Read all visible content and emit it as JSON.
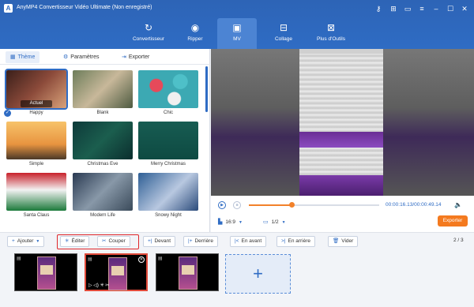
{
  "app": {
    "logo_text": "A",
    "title": "AnyMP4 Convertisseur Vidéo Ultimate (Non enregistré)",
    "titlebar_icons": [
      "key-icon",
      "cart-icon",
      "chat-icon",
      "menu-icon",
      "minimize-icon",
      "maximize-icon",
      "close-icon"
    ]
  },
  "nav": {
    "tabs": [
      {
        "label": "Convertisseur",
        "icon": "convert-icon"
      },
      {
        "label": "Ripper",
        "icon": "disc-icon"
      },
      {
        "label": "MV",
        "icon": "mv-icon",
        "active": true
      },
      {
        "label": "Collage",
        "icon": "collage-icon"
      },
      {
        "label": "Plus d'Outils",
        "icon": "toolbox-icon"
      }
    ]
  },
  "left_panel": {
    "tabs": [
      {
        "label": "Thème",
        "icon": "grid-icon",
        "active": true
      },
      {
        "label": "Paramètres",
        "icon": "settings-icon"
      },
      {
        "label": "Exporter",
        "icon": "export-icon"
      }
    ],
    "themes": [
      {
        "label": "Happy",
        "badge": "Actuel",
        "selected": true
      },
      {
        "label": "Blank"
      },
      {
        "label": "Chic"
      },
      {
        "label": "Simple"
      },
      {
        "label": "Christmas Eve"
      },
      {
        "label": "Merry Christmas"
      },
      {
        "label": "Santa Claus"
      },
      {
        "label": "Modern Life"
      },
      {
        "label": "Snowy Night"
      }
    ]
  },
  "player": {
    "current_time": "00:00:16.13",
    "total_time": "/00:00:49.14",
    "progress": 0.33,
    "aspect_ratio": "16:9",
    "page": "1/2",
    "export_label": "Exporter"
  },
  "toolbar": {
    "add_label": "Ajouter",
    "edit_label": "Éditer",
    "cut_label": "Couper",
    "front_label": "Devant",
    "back_label": "Derrière",
    "forward_label": "En avant",
    "backward_label": "En arrière",
    "clear_label": "Vider",
    "page_info": "2 / 3"
  },
  "timeline": {
    "clips": 3,
    "selected_clip": 2,
    "add_symbol": "+"
  },
  "colors": {
    "brand_blue": "#2f6cc4",
    "accent_orange": "#f47a1f",
    "highlight_red": "#e0262a"
  }
}
